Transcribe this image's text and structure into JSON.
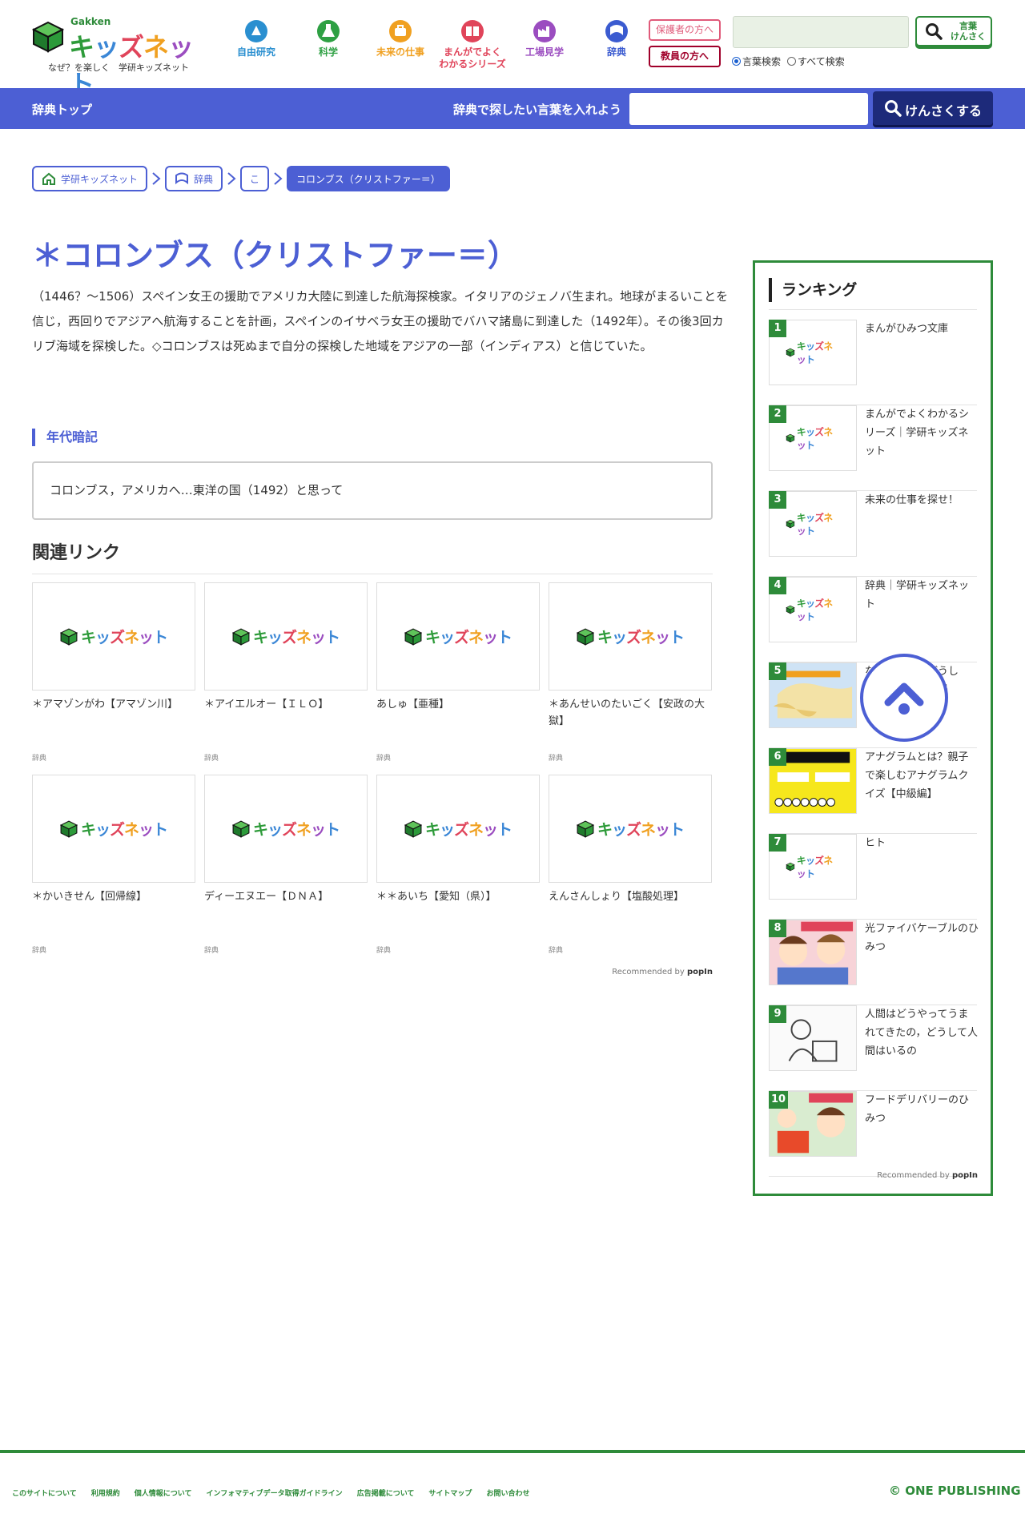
{
  "header": {
    "logo": {
      "brand_top": "Gakken",
      "brand_main": [
        "キ",
        "ッ",
        "ズ",
        "ネ",
        "ッ",
        "ト"
      ],
      "tagline": "なぜ？を楽しく　学研キッズネット"
    },
    "nav": [
      {
        "label": "自由研究",
        "color": "#2a8fd0"
      },
      {
        "label": "科学",
        "color": "#2ea043"
      },
      {
        "label": "未来の仕事",
        "color": "#f0a020"
      },
      {
        "label": "まんがでよく\nわかるシリーズ",
        "color": "#e0445a"
      },
      {
        "label": "工場見学",
        "color": "#9b4dc0"
      },
      {
        "label": "辞典",
        "color": "#3b5bd0"
      }
    ],
    "guardian_label": "保護者の方へ",
    "teacher_label": "教員の方へ",
    "search_button_label": "言葉\nけんさく",
    "radio_options": [
      {
        "label": "言葉検索",
        "checked": true
      },
      {
        "label": "すべて検索",
        "checked": false
      }
    ]
  },
  "dict_bar": {
    "top_label": "辞典トップ",
    "prompt": "辞典で探したい言葉を入れよう",
    "button_label": "けんさくする"
  },
  "breadcrumb": [
    {
      "label": "学研キッズネット",
      "icon": "home-icon"
    },
    {
      "label": "辞典",
      "icon": "book-icon"
    },
    {
      "label": "こ",
      "icon": ""
    },
    {
      "label": "コロンブス（クリストファー＝）",
      "icon": ""
    }
  ],
  "article": {
    "title": "＊コロンブス（クリストファー＝）",
    "body_lines": [
      "（1446？～1506）スペイン女王の援助でアメリカ大陸に到達した航海探検家。イタリアのジェノバ生まれ。地球がまるいことを",
      "信じ，西回りでアジアへ航海することを計画，スペインのイサベラ女王の援助でバハマ諸島に到達した（1492年）。その後3回カ",
      "リブ海域を探検した。◇コロンブスは死ぬまで自分の探検した地域をアジアの一部（インディアス）と信じていた。"
    ],
    "memo_heading": "年代暗記",
    "memo_text": "コロンブス，アメリカへ…東洋の国（1492）と思って"
  },
  "related": {
    "heading": "関連リンク",
    "items": [
      {
        "title": "＊アマゾンがわ【アマゾン川】",
        "category": "辞典"
      },
      {
        "title": "＊アイエルオー【ＩＬＯ】",
        "category": "辞典"
      },
      {
        "title": "あしゅ【亜種】",
        "category": "辞典"
      },
      {
        "title": "＊あんせいのたいごく【安政の大獄】",
        "category": "辞典"
      },
      {
        "title": "＊かいきせん【回帰線】",
        "category": "辞典"
      },
      {
        "title": "ディーエヌエー【ＤＮＡ】",
        "category": "辞典"
      },
      {
        "title": "＊＊あいち【愛知（県）】",
        "category": "辞典"
      },
      {
        "title": "えんさんしょり【塩酸処理】",
        "category": "辞典"
      }
    ],
    "recommended_prefix": "Recommended by",
    "recommended_brand": "popIn"
  },
  "ranking": {
    "heading": "ランキング",
    "items": [
      {
        "rank": "1",
        "title": "まんがひみつ文庫",
        "thumb": "logo"
      },
      {
        "rank": "2",
        "title": "まんがでよくわかるシリーズ｜学研キッズネット",
        "thumb": "logo"
      },
      {
        "rank": "3",
        "title": "未来の仕事を探せ！",
        "thumb": "logo"
      },
      {
        "rank": "4",
        "title": "辞典｜学研キッズネット",
        "thumb": "logo"
      },
      {
        "rank": "5",
        "title": "なぜロシアはどうして？ウクライナ侵",
        "thumb": "map"
      },
      {
        "rank": "6",
        "title": "アナグラムとは？親子で楽しむアナグラムクイズ【中級編】",
        "thumb": "quiz"
      },
      {
        "rank": "7",
        "title": "ヒト",
        "thumb": "logo"
      },
      {
        "rank": "8",
        "title": "光ファイバケーブルのひみつ",
        "thumb": "manga"
      },
      {
        "rank": "9",
        "title": "人間はどうやってうまれてきたの，どうして人間はいるの",
        "thumb": "sketch"
      },
      {
        "rank": "10",
        "title": "フードデリバリーのひみつ",
        "thumb": "manga2"
      }
    ],
    "recommended_prefix": "Recommended by",
    "recommended_brand": "popIn"
  },
  "footer": {
    "links": [
      "このサイトについて",
      "利用規約",
      "個人情報について",
      "インフォマティブデータ取得ガイドライン",
      "広告掲載について",
      "サイトマップ",
      "お問い合わせ"
    ],
    "copyright": "© ONE PUBLISHING"
  },
  "colors": {
    "accent_blue": "#4c5fd4",
    "brand_green": "#2e8b3a",
    "dark_navy": "#1d2a7a"
  }
}
